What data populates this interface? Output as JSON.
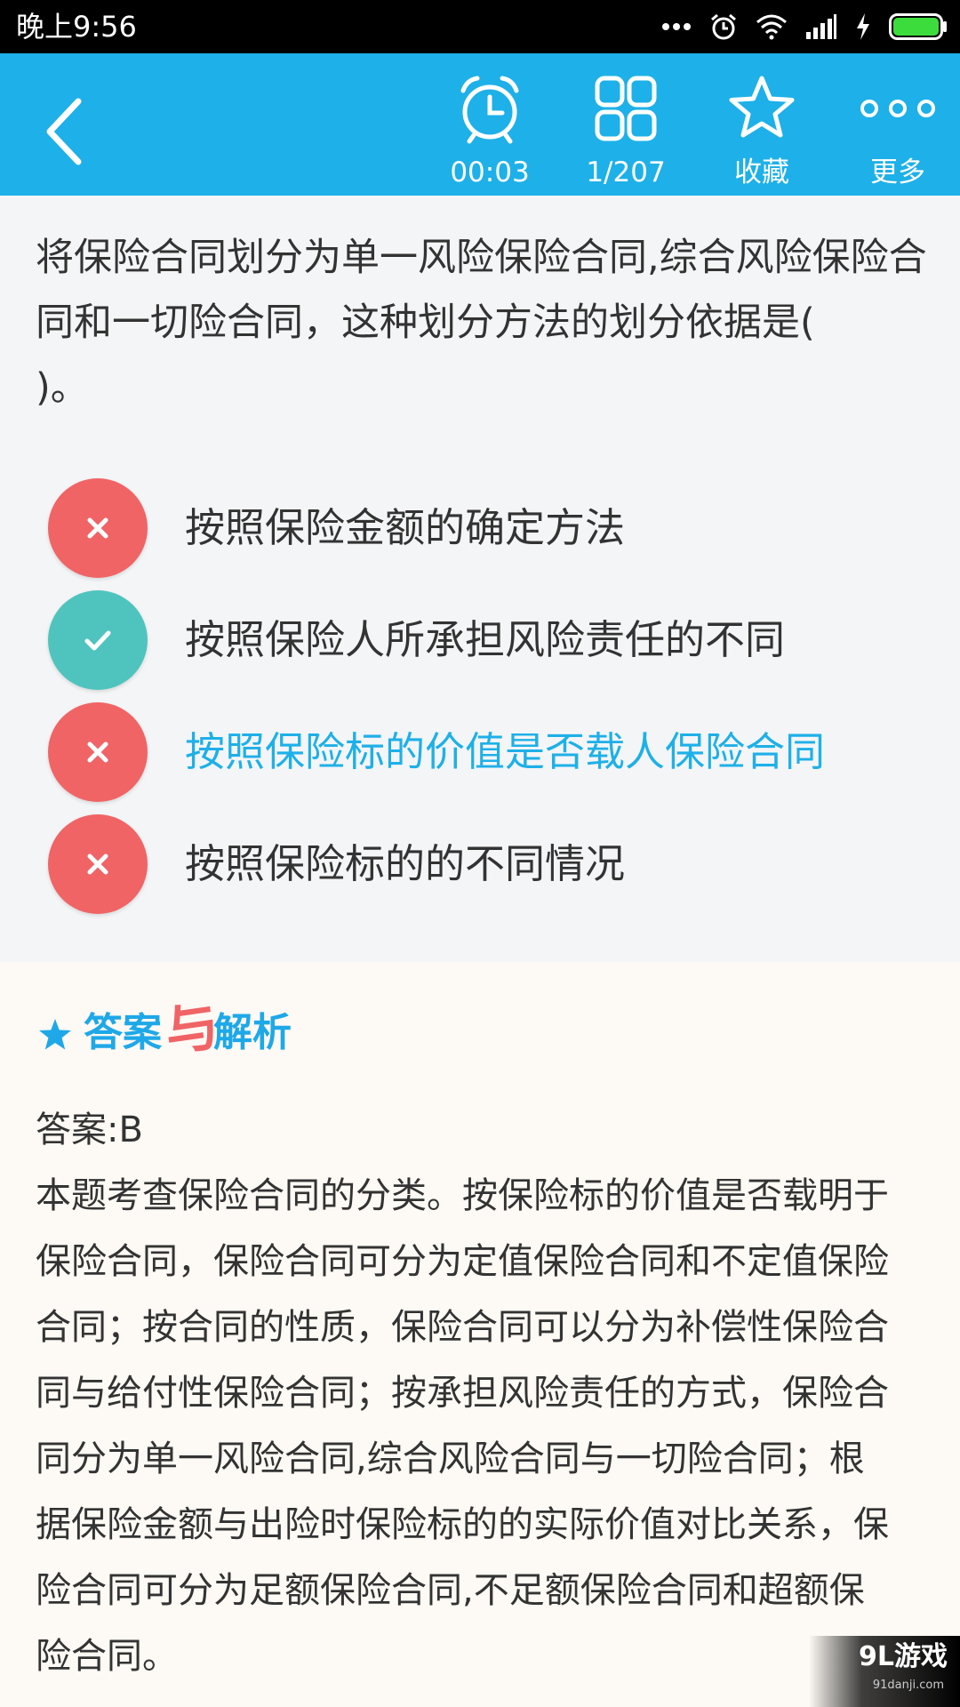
{
  "status_bar": {
    "time": "晚上9:56"
  },
  "toolbar": {
    "timer_label": "00:03",
    "count_label": "1/207",
    "favorite_label": "收藏",
    "more_label": "更多",
    "accent_color": "#1eb0e8"
  },
  "question": {
    "text": "将保险合同划分为单一风险保险合同,综合风险保险合同和一切险合同，这种划分方法的划分依据是(　　)。",
    "options": [
      {
        "label": "按照保险金额的确定方法",
        "state": "wrong",
        "icon": "close-icon"
      },
      {
        "label": "按照保险人所承担风险责任的不同",
        "state": "correct",
        "icon": "check-icon"
      },
      {
        "label": "按照保险标的价值是否载人保险合同",
        "state": "wrong-selected",
        "icon": "close-icon"
      },
      {
        "label": "按照保险标的的不同情况",
        "state": "wrong",
        "icon": "close-icon"
      }
    ],
    "wrong_color": "#f06466",
    "correct_color": "#4fc4bf"
  },
  "analysis": {
    "heading_part1": "答案",
    "heading_connector": "与",
    "heading_part2": "解析",
    "answer": "答案:B",
    "explanation": "本题考查保险合同的分类。按保险标的价值是否载明于保险合同，保险合同可分为定值保险合同和不定值保险合同；按合同的性质，保险合同可以分为补偿性保险合同与给付性保险合同；按承担风险责任的方式，保险合同分为单一风险合同,综合风险合同与一切险合同；根据保险金额与出险时保险标的的实际价值对比关系，保险合同可分为足额保险合同,不足额保险合同和超额保险合同。"
  },
  "watermark": {
    "main": "9L游戏",
    "sub": "91danji.com"
  }
}
